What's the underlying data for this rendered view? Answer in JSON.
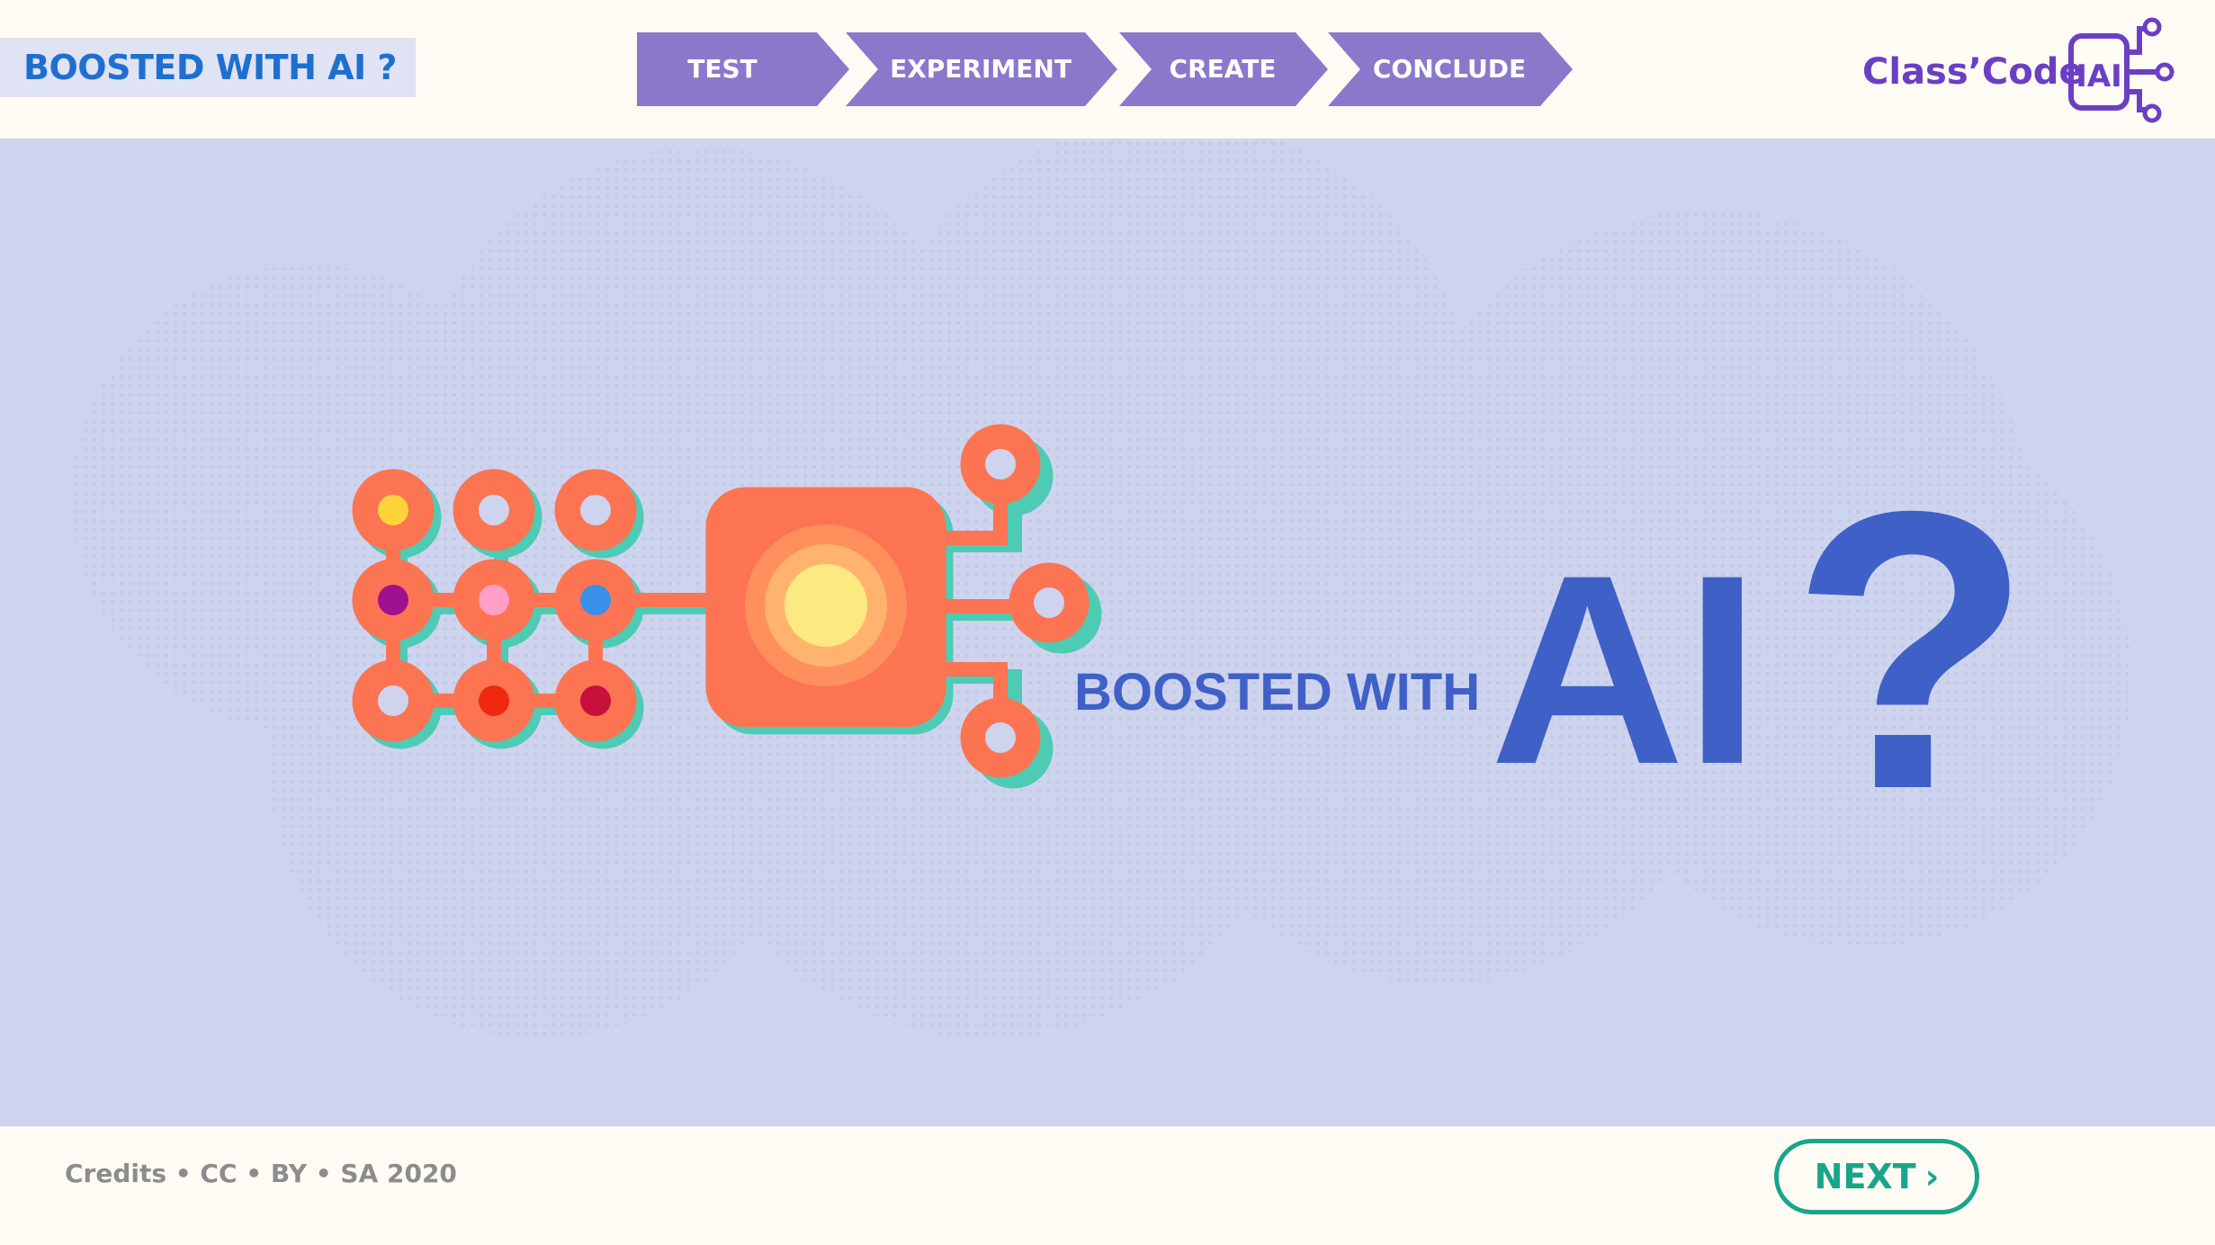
{
  "header": {
    "page_title": "BOOSTED WITH AI ?",
    "steps": [
      {
        "label": "TEST"
      },
      {
        "label": "EXPERIMENT"
      },
      {
        "label": "CREATE"
      },
      {
        "label": "CONCLUDE"
      }
    ],
    "logo": {
      "text": "Class’Code",
      "badge": "IAI"
    }
  },
  "hero": {
    "subtitle": "BOOSTED WITH",
    "big_text": "AI",
    "question_mark": "?"
  },
  "footer": {
    "credits": "Credits • CC • BY • SA 2020",
    "next_label": "NEXT",
    "next_icon": "chevron-right-icon"
  },
  "colors": {
    "title_blue": "#1f6fd0",
    "step_purple": "#8a78cb",
    "logo_purple": "#6b3fc4",
    "stage_bg": "#ced4ee",
    "hero_blue": "#3f60c6",
    "circuit_orange": "#fc7452",
    "circuit_teal": "#4ecbb4",
    "next_green": "#1aa58a"
  }
}
